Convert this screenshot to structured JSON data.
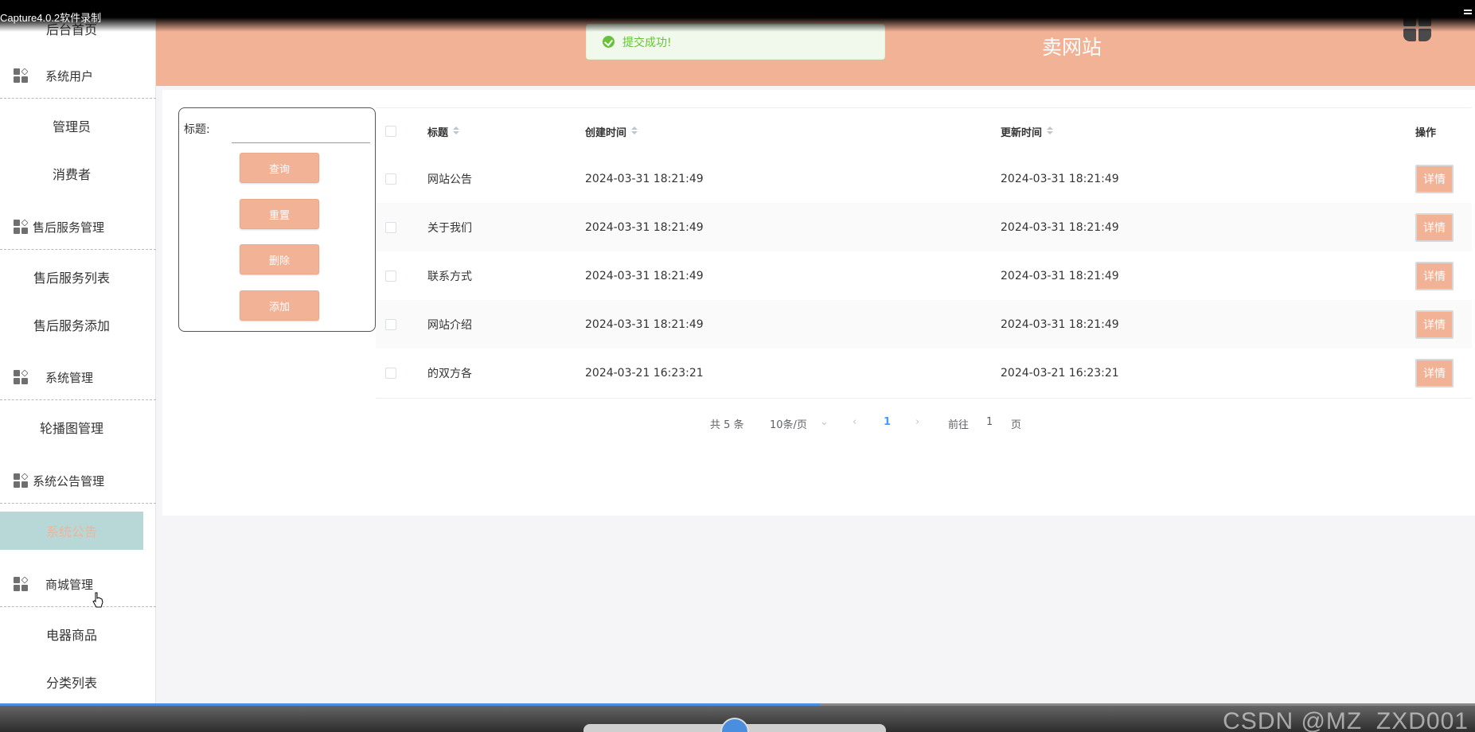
{
  "capture": {
    "title": "Capture4.0.2软件录制"
  },
  "sidebar": {
    "home": "后台首页",
    "groups": [
      {
        "label": "系统用户",
        "items": [
          "管理员",
          "消费者"
        ]
      },
      {
        "label": "售后服务管理",
        "items": [
          "售后服务列表",
          "售后服务添加"
        ]
      },
      {
        "label": "系统管理",
        "items": [
          "轮播图管理"
        ]
      },
      {
        "label": "系统公告管理",
        "items": [
          "系统公告"
        ]
      },
      {
        "label": "商城管理",
        "items": [
          "电器商品",
          "分类列表"
        ]
      }
    ],
    "active_item": "系统公告"
  },
  "header": {
    "title": "卖网站"
  },
  "toast": {
    "text": "提交成功!"
  },
  "search": {
    "label": "标题:",
    "value": "",
    "buttons": {
      "query": "查询",
      "reset": "重置",
      "delete": "删除",
      "add": "添加"
    }
  },
  "table": {
    "columns": {
      "title": "标题",
      "created": "创建时间",
      "updated": "更新时间",
      "action": "操作"
    },
    "action_label": "详情",
    "rows": [
      {
        "title": "网站公告",
        "created": "2024-03-31 18:21:49",
        "updated": "2024-03-31 18:21:49"
      },
      {
        "title": "关于我们",
        "created": "2024-03-31 18:21:49",
        "updated": "2024-03-31 18:21:49"
      },
      {
        "title": "联系方式",
        "created": "2024-03-31 18:21:49",
        "updated": "2024-03-31 18:21:49"
      },
      {
        "title": "网站介绍",
        "created": "2024-03-31 18:21:49",
        "updated": "2024-03-31 18:21:49"
      },
      {
        "title": "的双方各",
        "created": "2024-03-21 16:23:21",
        "updated": "2024-03-21 16:23:21"
      }
    ]
  },
  "pager": {
    "total": "共 5 条",
    "page_size": "10条/页",
    "current": "1",
    "goto_prefix": "前往",
    "goto_value": "1",
    "goto_suffix": "页"
  },
  "watermark": "CSDN @MZ_ZXD001",
  "colors": {
    "accent": "#f2b296",
    "active_bg": "#b8d8d8",
    "success": "#67c23a"
  }
}
